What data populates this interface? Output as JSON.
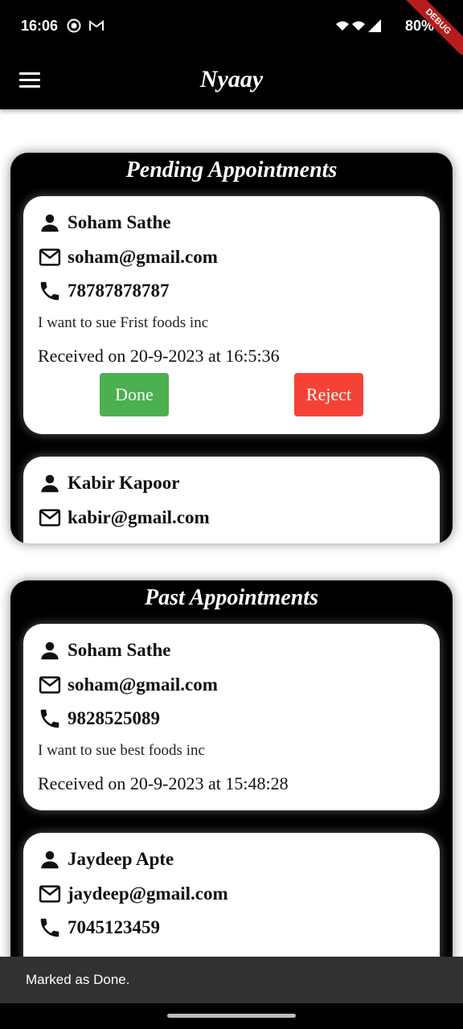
{
  "status_bar": {
    "time": "16:06",
    "battery": "80%"
  },
  "debug_banner": "DEBUG",
  "app_bar": {
    "title": "Nyaay"
  },
  "pending": {
    "title": "Pending Appointments",
    "items": [
      {
        "name": "Soham Sathe",
        "email": "soham@gmail.com",
        "phone": "78787878787",
        "message": "I want to sue Frist foods inc",
        "received": "Received on 20-9-2023 at 16:5:36",
        "done_label": "Done",
        "reject_label": "Reject"
      },
      {
        "name": "Kabir Kapoor",
        "email": "kabir@gmail.com"
      }
    ]
  },
  "past": {
    "title": "Past Appointments",
    "items": [
      {
        "name": "Soham Sathe",
        "email": "soham@gmail.com",
        "phone": "9828525089",
        "message": "I want to sue best foods inc",
        "received": "Received on 20-9-2023 at 15:48:28"
      },
      {
        "name": "Jaydeep Apte",
        "email": "jaydeep@gmail.com",
        "phone": "7045123459"
      }
    ]
  },
  "snackbar": {
    "text": "Marked as Done."
  },
  "icons": {
    "person": "person-icon",
    "email": "email-icon",
    "phone": "phone-icon",
    "menu": "menu-icon"
  },
  "colors": {
    "done": "#4caf50",
    "reject": "#f44336",
    "appbar": "#000000"
  }
}
